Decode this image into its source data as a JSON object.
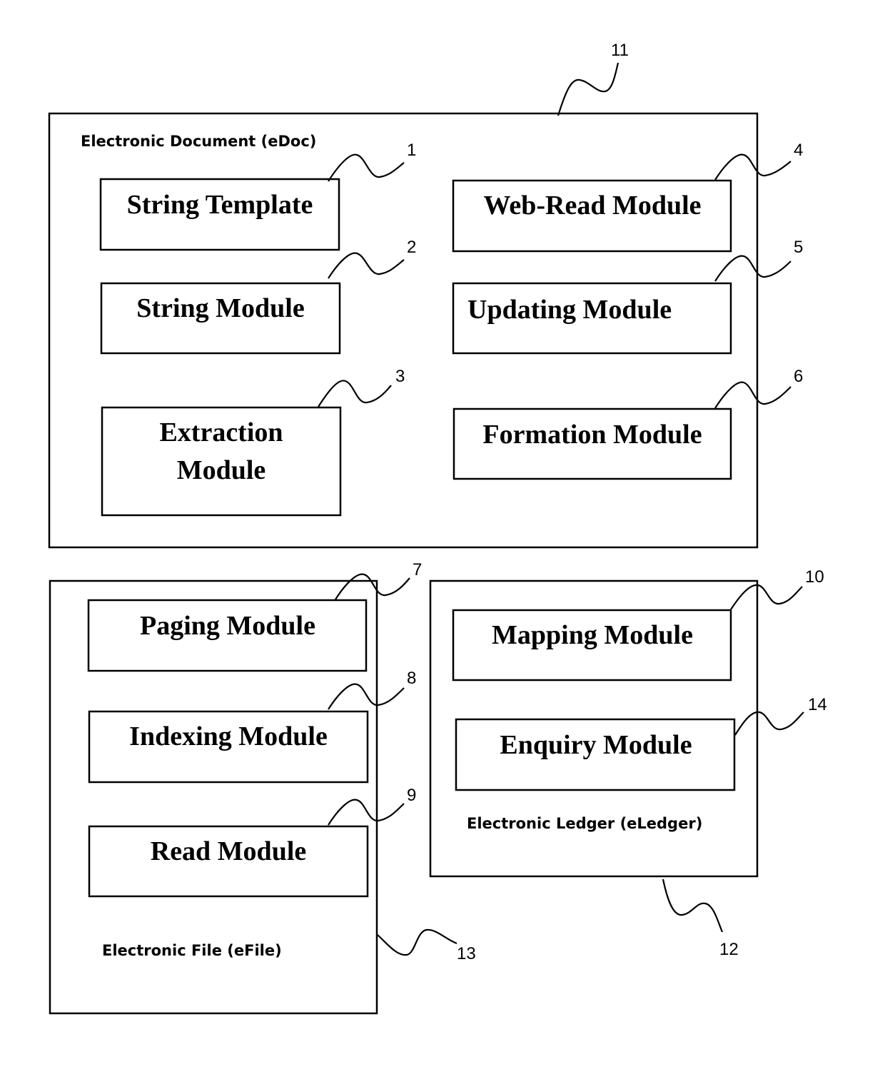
{
  "diagram": {
    "containers": {
      "edoc": {
        "label": "Electronic Document (eDoc)",
        "ref": "11"
      },
      "efile": {
        "label": "Electronic File (eFile)",
        "ref": "13"
      },
      "eledger": {
        "label": "Electronic Ledger (eLedger)",
        "ref": "12"
      }
    },
    "modules": {
      "string_template": {
        "label": "String Template",
        "ref": "1"
      },
      "string_module": {
        "label": "String Module",
        "ref": "2"
      },
      "extraction_module": {
        "label_line1": "Extraction",
        "label_line2": "Module",
        "ref": "3"
      },
      "web_read_module": {
        "label": "Web-Read Module",
        "ref": "4"
      },
      "updating_module": {
        "label": "Updating Module",
        "ref": "5"
      },
      "formation_module": {
        "label": "Formation Module",
        "ref": "6"
      },
      "paging_module": {
        "label": "Paging Module",
        "ref": "7"
      },
      "indexing_module": {
        "label": "Indexing Module",
        "ref": "8"
      },
      "read_module": {
        "label": "Read Module",
        "ref": "9"
      },
      "mapping_module": {
        "label": "Mapping Module",
        "ref": "10"
      },
      "enquiry_module": {
        "label": "Enquiry Module",
        "ref": "14"
      }
    }
  }
}
